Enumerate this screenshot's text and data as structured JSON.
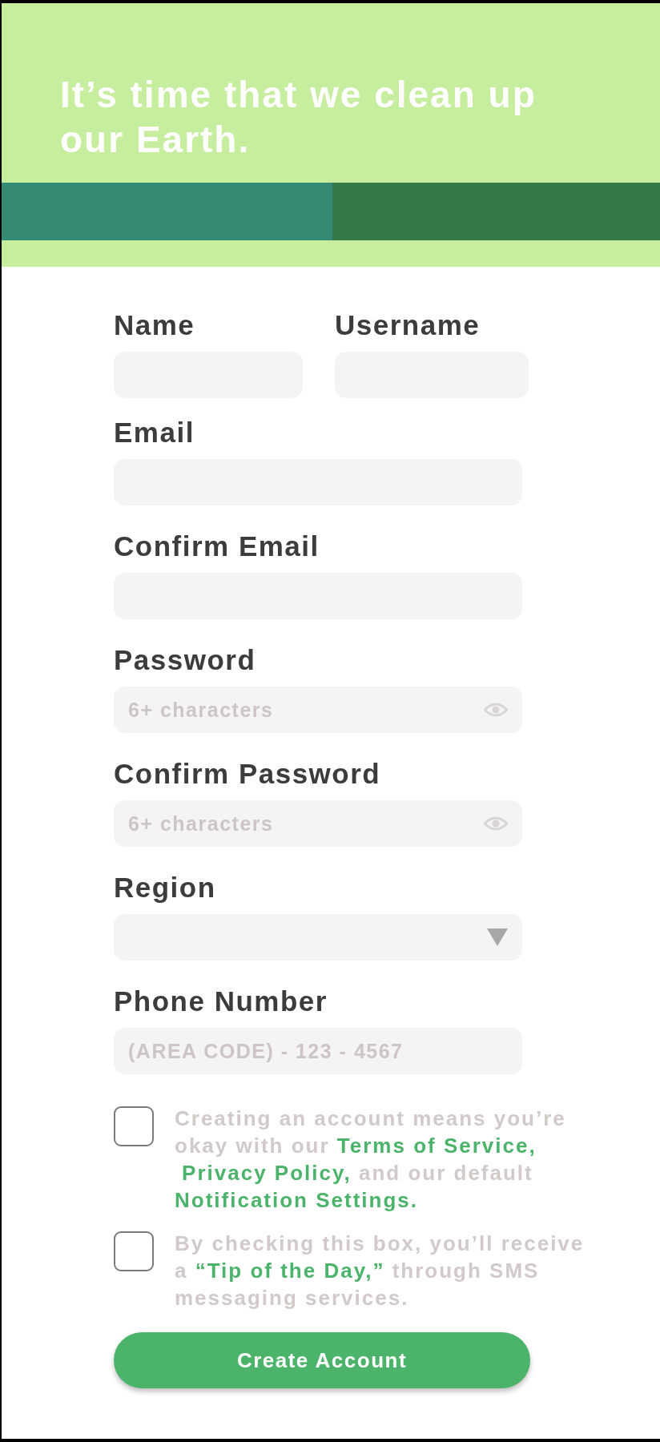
{
  "headline": "It’s time that we clean up our Earth.",
  "form_rows": [
    {
      "fields": [
        {
          "kind": "text",
          "label": "Name"
        },
        {
          "kind": "text",
          "label": "Username"
        }
      ]
    },
    {
      "fields": [
        {
          "kind": "text",
          "label": "Email"
        }
      ]
    },
    {
      "fields": [
        {
          "kind": "text",
          "label": "Confirm Email"
        }
      ]
    },
    {
      "fields": [
        {
          "kind": "password",
          "label": "Password",
          "placeholder": "6+ characters"
        }
      ]
    },
    {
      "fields": [
        {
          "kind": "password",
          "label": "Confirm Password",
          "placeholder": "6+ characters"
        }
      ]
    },
    {
      "fields": [
        {
          "kind": "select",
          "label": "Region"
        }
      ]
    },
    {
      "fields": [
        {
          "kind": "text",
          "label": "Phone Number",
          "placeholder": "(AREA CODE) - 123 - 4567"
        }
      ]
    }
  ],
  "agreements": [
    {
      "checked": false,
      "segments": [
        {
          "text": "Creating an account means you’re okay with our "
        },
        {
          "text": "Terms of Service,",
          "link": true
        },
        {
          "text": "Privacy Policy,",
          "link": true
        },
        {
          "text": " and our default "
        },
        {
          "text": "Notification Settings.",
          "link": true
        }
      ]
    },
    {
      "checked": false,
      "segments": [
        {
          "text": "By checking this box, you’ll receive a "
        },
        {
          "text": "“Tip of the Day,”",
          "link": true
        },
        {
          "text": " through SMS messaging services."
        }
      ]
    }
  ],
  "submit_button": "Create Account"
}
